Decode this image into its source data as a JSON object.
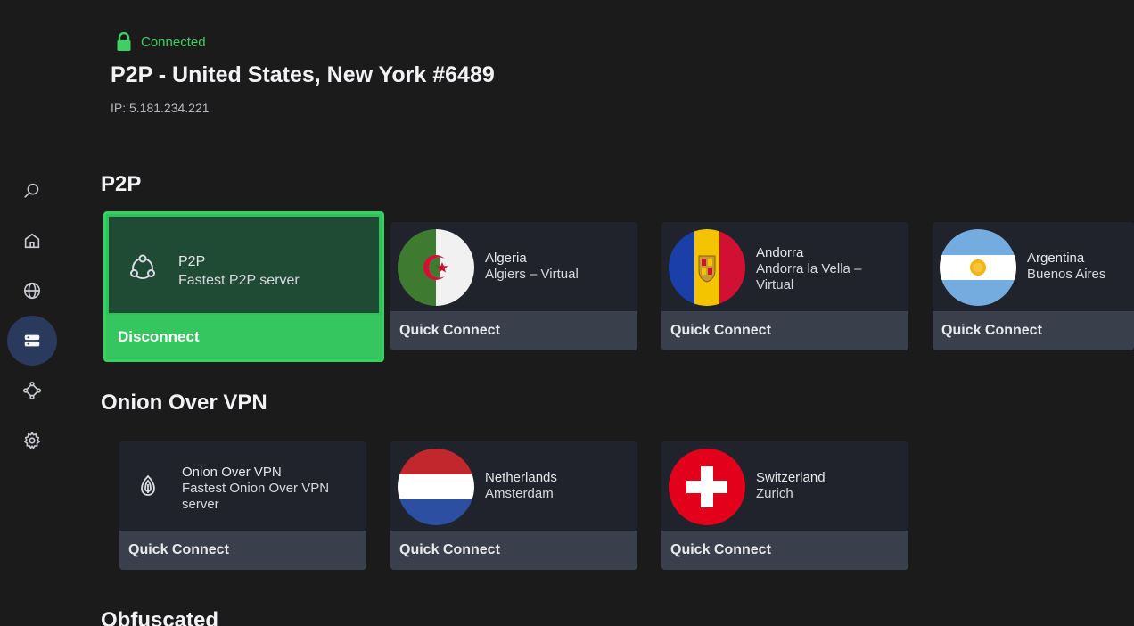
{
  "header": {
    "status": "Connected",
    "server_name": "P2P - United States, New York #6489",
    "ip": "IP: 5.181.234.221"
  },
  "nav": {
    "items": [
      {
        "icon": "search-icon"
      },
      {
        "icon": "home-icon"
      },
      {
        "icon": "globe-icon"
      },
      {
        "icon": "servers-icon",
        "active": true
      },
      {
        "icon": "mesh-icon"
      },
      {
        "icon": "gear-icon"
      }
    ]
  },
  "sections": {
    "p2p": {
      "title": "P2P",
      "cards": [
        {
          "line1": "P2P",
          "line2": "Fastest P2P server",
          "action": "Disconnect",
          "selected": true
        },
        {
          "line1": "Algeria",
          "line2": "Algiers – Virtual",
          "action": "Quick Connect",
          "flag": "algeria"
        },
        {
          "line1": "Andorra",
          "line2": "Andorra la Vella –",
          "line3": "Virtual",
          "action": "Quick Connect",
          "flag": "andorra"
        },
        {
          "line1": "Argentina",
          "line2": "Buenos Aires",
          "action": "Quick Connect",
          "flag": "argentina"
        }
      ]
    },
    "onion": {
      "title": "Onion Over VPN",
      "cards": [
        {
          "line1": "Onion Over VPN",
          "line2": "Fastest Onion Over VPN",
          "line3": "server",
          "action": "Quick Connect"
        },
        {
          "line1": "Netherlands",
          "line2": "Amsterdam",
          "action": "Quick Connect",
          "flag": "netherlands"
        },
        {
          "line1": "Switzerland",
          "line2": "Zurich",
          "action": "Quick Connect",
          "flag": "switzerland"
        }
      ]
    },
    "obfuscated": {
      "title": "Obfuscated"
    }
  },
  "colors": {
    "connected": "#3fcf62",
    "selected_card": "#36c65f",
    "nav_active": "#2a3a5c"
  }
}
